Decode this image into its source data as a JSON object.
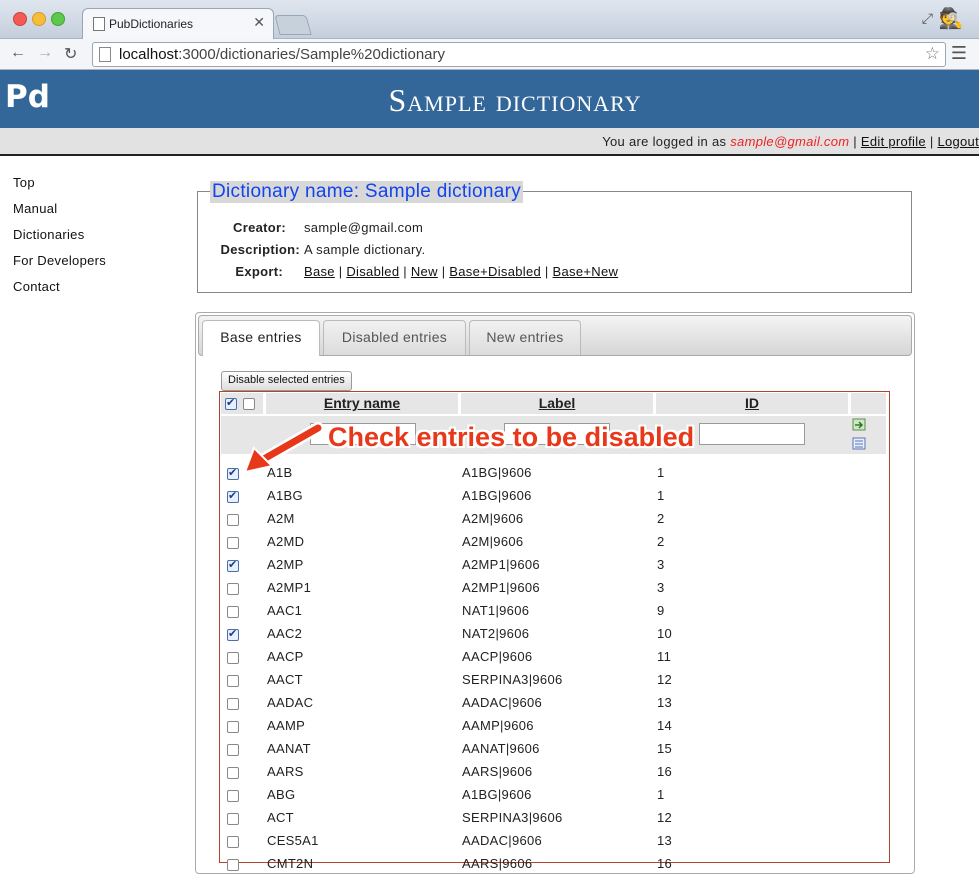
{
  "browser": {
    "tab_title": "PubDictionaries",
    "url_host": "localhost",
    "url_path": ":3000/dictionaries/Sample%20dictionary"
  },
  "header": {
    "logo": "Pd",
    "title": "Sample dictionary"
  },
  "userbar": {
    "prefix": "You are logged in as",
    "email": "sample@gmail.com",
    "edit_profile": "Edit profile",
    "logout": "Logout"
  },
  "sidebar": {
    "items": [
      {
        "label": "Top"
      },
      {
        "label": "Manual"
      },
      {
        "label": "Dictionaries"
      },
      {
        "label": "For Developers"
      },
      {
        "label": "Contact"
      }
    ]
  },
  "dictionary": {
    "legend": "Dictionary name: Sample dictionary",
    "creator_label": "Creator:",
    "creator": "sample@gmail.com",
    "description_label": "Description:",
    "description": "A sample dictionary.",
    "export_label": "Export:",
    "export_links": [
      "Base",
      "Disabled",
      "New",
      "Base+Disabled",
      "Base+New"
    ]
  },
  "tabs": [
    {
      "label": "Base entries",
      "active": true
    },
    {
      "label": "Disabled entries",
      "active": false
    },
    {
      "label": "New entries",
      "active": false
    }
  ],
  "disable_button": "Disable selected entries",
  "table": {
    "columns": [
      "Entry name",
      "Label",
      "ID"
    ],
    "rows": [
      {
        "name": "A1B",
        "label": "A1BG|9606",
        "id": "1",
        "checked": true
      },
      {
        "name": "A1BG",
        "label": "A1BG|9606",
        "id": "1",
        "checked": true
      },
      {
        "name": "A2M",
        "label": "A2M|9606",
        "id": "2",
        "checked": false
      },
      {
        "name": "A2MD",
        "label": "A2M|9606",
        "id": "2",
        "checked": false
      },
      {
        "name": "A2MP",
        "label": "A2MP1|9606",
        "id": "3",
        "checked": true
      },
      {
        "name": "A2MP1",
        "label": "A2MP1|9606",
        "id": "3",
        "checked": false
      },
      {
        "name": "AAC1",
        "label": "NAT1|9606",
        "id": "9",
        "checked": false
      },
      {
        "name": "AAC2",
        "label": "NAT2|9606",
        "id": "10",
        "checked": true
      },
      {
        "name": "AACP",
        "label": "AACP|9606",
        "id": "11",
        "checked": false
      },
      {
        "name": "AACT",
        "label": "SERPINA3|9606",
        "id": "12",
        "checked": false
      },
      {
        "name": "AADAC",
        "label": "AADAC|9606",
        "id": "13",
        "checked": false
      },
      {
        "name": "AAMP",
        "label": "AAMP|9606",
        "id": "14",
        "checked": false
      },
      {
        "name": "AANAT",
        "label": "AANAT|9606",
        "id": "15",
        "checked": false
      },
      {
        "name": "AARS",
        "label": "AARS|9606",
        "id": "16",
        "checked": false
      },
      {
        "name": "ABG",
        "label": "A1BG|9606",
        "id": "1",
        "checked": false
      },
      {
        "name": "ACT",
        "label": "SERPINA3|9606",
        "id": "12",
        "checked": false
      },
      {
        "name": "CES5A1",
        "label": "AADAC|9606",
        "id": "13",
        "checked": false
      },
      {
        "name": "CMT2N",
        "label": "AARS|9606",
        "id": "16",
        "checked": false
      }
    ]
  },
  "annotation": "Check entries to be disabled",
  "colors": {
    "header_bg": "#336699",
    "legend_text": "#1144ee",
    "annotation": "#e8381a",
    "table_border": "#b4432e"
  }
}
